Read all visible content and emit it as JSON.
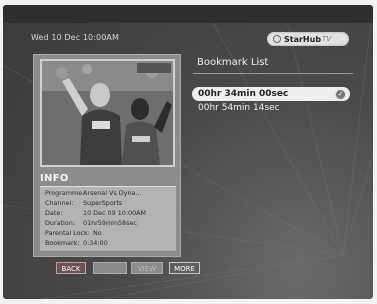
{
  "header": {
    "datetime": "Wed 10 Dec 10:00AM",
    "logo_brand": "StarHub",
    "logo_suffix": "TV"
  },
  "info": {
    "title": "INFO",
    "rows": [
      {
        "key": "Programme:",
        "value": "Arsenal Vs Dyna..."
      },
      {
        "key": "Channel:",
        "value": "SuperSports"
      },
      {
        "key": "Date:",
        "value": "10 Dec 09 10:00AM"
      },
      {
        "key": "Duration:",
        "value": "01hr59min58sec"
      },
      {
        "key": "Parental Lock:",
        "value": "No"
      },
      {
        "key": "Bookmark:",
        "value": "0:34:00"
      }
    ]
  },
  "bookmarks": {
    "title": "Bookmark List",
    "items": [
      "00hr 34min 00sec",
      "00hr 54min 14sec"
    ],
    "selected_index": 0
  },
  "buttons": {
    "back": "BACK",
    "blank": "",
    "view": "VIEW",
    "more": "MORE"
  }
}
